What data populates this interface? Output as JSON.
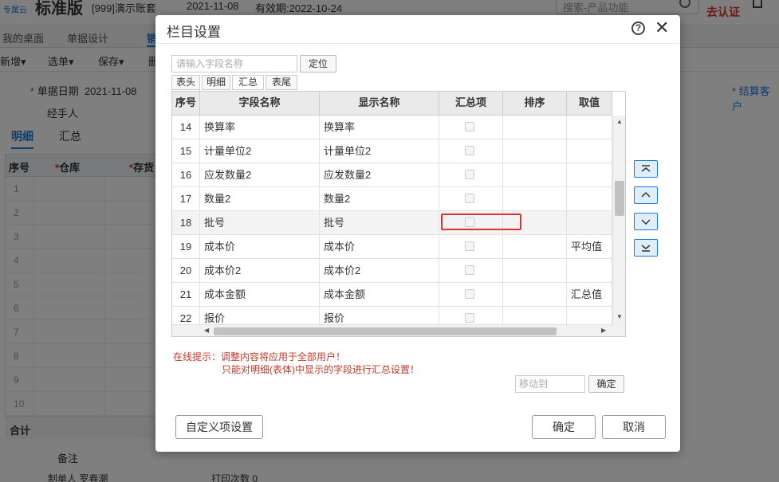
{
  "app": {
    "logo_text": "专属云",
    "edition": "标准版",
    "account": "[999]演示账套",
    "date": "2021-11-08",
    "validity": "有效期:2022-10-24",
    "search_placeholder": "搜索-产品功能",
    "certify": "去认证"
  },
  "nav": {
    "tabs": [
      "我的桌面",
      "单据设计",
      "销"
    ]
  },
  "toolbar": {
    "items": [
      "新增",
      "选单",
      "保存",
      "删"
    ]
  },
  "form": {
    "date_label": "单据日期",
    "date_value": "2021-11-08",
    "handler_label": "经手人",
    "settle_customer_label": "结算客户"
  },
  "subtabs": [
    "明细",
    "汇总"
  ],
  "grid": {
    "headers": [
      "序号",
      "仓库",
      "存货"
    ],
    "row_numbers": [
      "1",
      "2",
      "3",
      "4",
      "5",
      "6",
      "7",
      "8",
      "9",
      "10"
    ],
    "total_label": "合计"
  },
  "footer": {
    "remark_label": "备注",
    "maker_label": "制单人",
    "maker_value": "罗春潮",
    "print_label": "打印次数",
    "print_value": "0"
  },
  "dialog": {
    "title": "栏目设置",
    "field_search_placeholder": "请输入字段名称",
    "locate_label": "定位",
    "tabs": [
      "表头",
      "明细",
      "汇总",
      "表尾"
    ],
    "active_tab": "汇总",
    "columns": [
      "序号",
      "字段名称",
      "显示名称",
      "汇总项",
      "排序",
      "取值"
    ],
    "rows": [
      {
        "no": "14",
        "field": "换算率",
        "display": "换算率",
        "value": ""
      },
      {
        "no": "15",
        "field": "计量单位2",
        "display": "计量单位2",
        "value": ""
      },
      {
        "no": "16",
        "field": "应发数量2",
        "display": "应发数量2",
        "value": ""
      },
      {
        "no": "17",
        "field": "数量2",
        "display": "数量2",
        "value": ""
      },
      {
        "no": "18",
        "field": "批号",
        "display": "批号",
        "value": ""
      },
      {
        "no": "19",
        "field": "成本价",
        "display": "成本价",
        "value": "平均值"
      },
      {
        "no": "20",
        "field": "成本价2",
        "display": "成本价2",
        "value": ""
      },
      {
        "no": "21",
        "field": "成本金额",
        "display": "成本金额",
        "value": "汇总值"
      },
      {
        "no": "22",
        "field": "报价",
        "display": "报价",
        "value": ""
      }
    ],
    "notice_line1": "在线提示：调整内容将应用于全部用户！",
    "notice_line2": "只能对明细(表体)中显示的字段进行汇总设置！",
    "moveto_placeholder": "移动到",
    "moveto_confirm": "确定",
    "custom_button": "自定义项设置",
    "ok_button": "确定",
    "cancel_button": "取消"
  }
}
